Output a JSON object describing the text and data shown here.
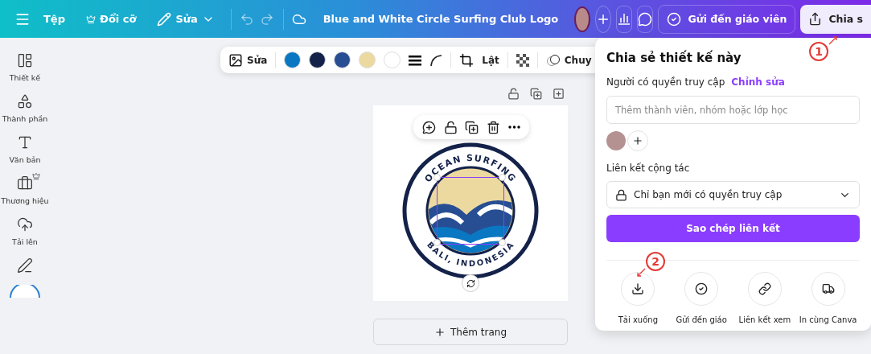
{
  "top_bar": {
    "menu": [
      {
        "label": "Tệp",
        "kind": "plain"
      },
      {
        "label": "Đổi cỡ",
        "kind": "premium"
      },
      {
        "label": "Sửa",
        "kind": "dropdown"
      }
    ],
    "title": "Blue and White Circle Surfing Club Logo",
    "send_button": "Gửi đến giáo viên",
    "share_button": "Chia s"
  },
  "toolbar": {
    "edit_label": "Sửa",
    "swatches": [
      {
        "color": "#0a77c2"
      },
      {
        "color": "#14224a"
      },
      {
        "color": "#274e93"
      },
      {
        "color": "#ecd9a0"
      },
      {
        "color": "#ffffff"
      }
    ],
    "flip_label": "Lật",
    "animate_label": "Chuy"
  },
  "sidebar": {
    "items": [
      {
        "label": "Thiết kế",
        "premium": false
      },
      {
        "label": "Thành phần",
        "premium": false
      },
      {
        "label": "Văn bản",
        "premium": false
      },
      {
        "label": "Thương hiệu",
        "premium": true
      },
      {
        "label": "Tải lên",
        "premium": false
      }
    ]
  },
  "canvas": {
    "logo": {
      "top_text": "OCEAN SURFING",
      "bottom_text": "BALI, INDONESIA"
    },
    "add_page_button": "Thêm trang"
  },
  "share_panel": {
    "title": "Chia sẻ thiết kế này",
    "access_label": "Người có quyền truy cập",
    "edit_link": "Chỉnh sửa",
    "invite_placeholder": "Thêm thành viên, nhóm hoặc lớp học",
    "link_label": "Liên kết cộng tác",
    "access_option": "Chỉ bạn mới có quyền truy cập",
    "copy_button": "Sao chép liên kết",
    "actions": [
      {
        "label": "Tải xuống"
      },
      {
        "label": "Gửi đến giáo"
      },
      {
        "label": "Liên kết xem"
      },
      {
        "label": "In cùng Canva"
      }
    ]
  },
  "annotations": [
    {
      "label": "1"
    },
    {
      "label": "2"
    }
  ]
}
